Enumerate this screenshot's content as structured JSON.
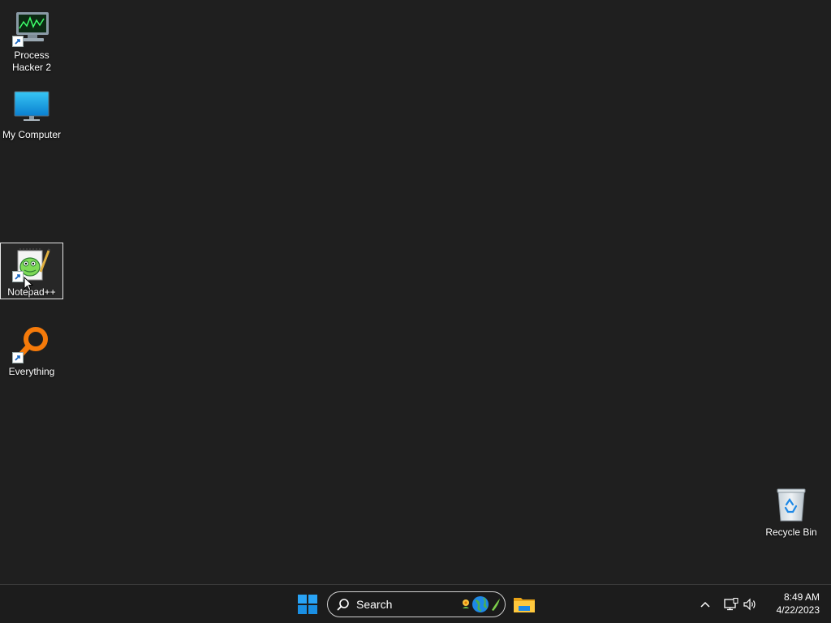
{
  "desktop": {
    "icons": [
      {
        "label": "Process Hacker 2",
        "icon": "process-hacker-icon",
        "shortcut": true
      },
      {
        "label": "My Computer",
        "icon": "monitor-icon",
        "shortcut": false
      },
      {
        "label": "Notepad++",
        "icon": "notepad-plus-plus-icon",
        "shortcut": true,
        "selected": true
      },
      {
        "label": "Everything",
        "icon": "everything-search-icon",
        "shortcut": true
      },
      {
        "label": "Recycle Bin",
        "icon": "recycle-bin-icon",
        "shortcut": false
      }
    ]
  },
  "taskbar": {
    "start_icon": "windows-logo-icon",
    "search": {
      "label": "Search",
      "icon": "search-icon"
    },
    "pinned": [
      {
        "icon": "file-explorer-icon"
      }
    ],
    "tray": {
      "chevron_icon": "chevron-up-icon",
      "network_icon": "network-icon",
      "volume_icon": "volume-icon",
      "time": "8:49 AM",
      "date": "4/22/2023"
    }
  },
  "colors": {
    "desktop_bg": "#1f1f1f",
    "taskbar_bg": "#1c1c1c",
    "accent": "#0a84ff",
    "everything_orange": "#f57a0a"
  }
}
